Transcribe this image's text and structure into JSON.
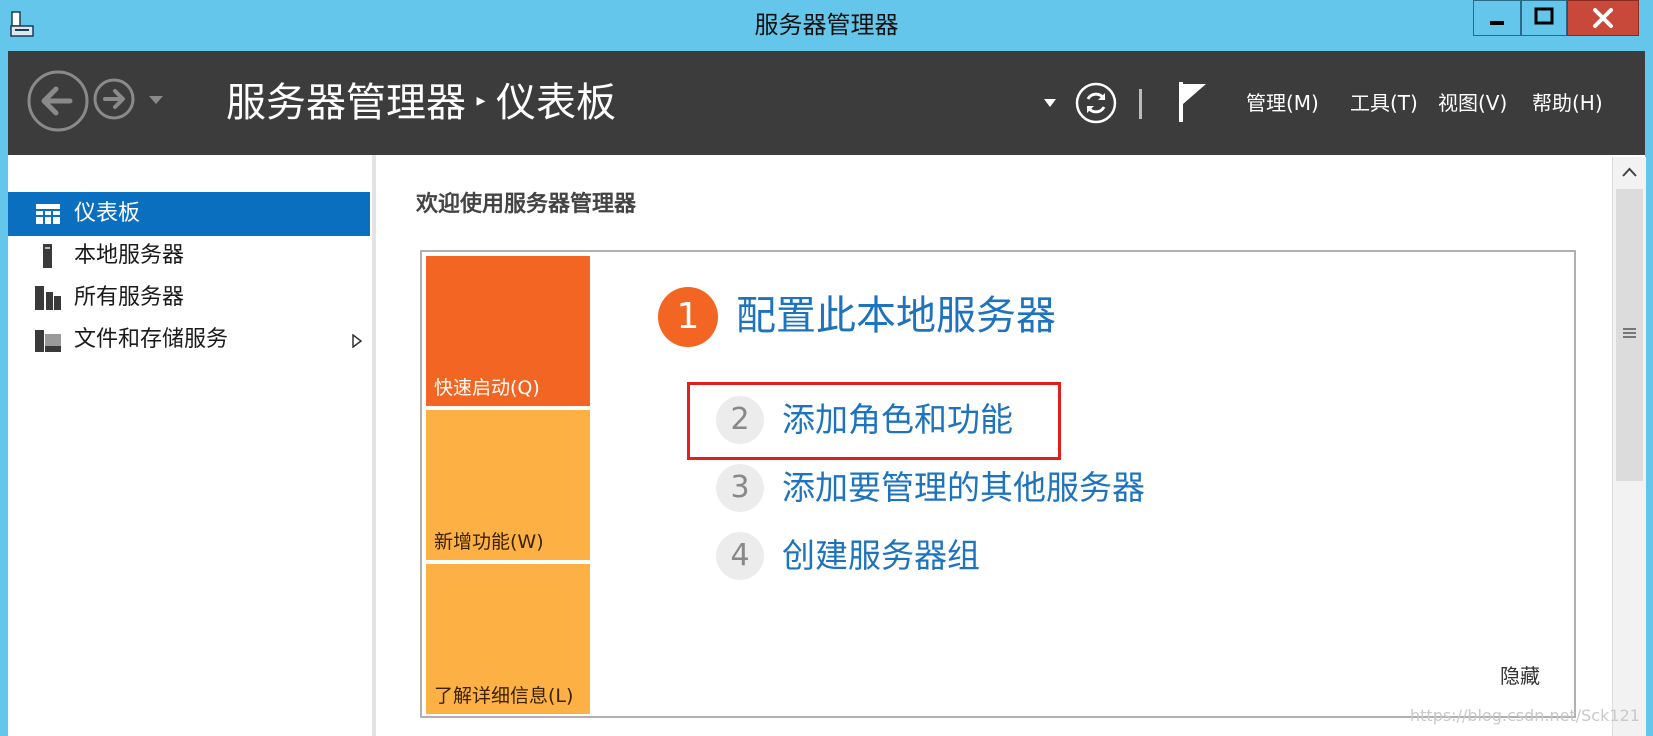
{
  "window": {
    "title": "服务器管理器",
    "buttons": [
      "minimize",
      "maximize",
      "close"
    ]
  },
  "header": {
    "breadcrumb_root": "服务器管理器",
    "breadcrumb_separator": "▸",
    "breadcrumb_current": "仪表板",
    "menu": {
      "manage": "管理(M)",
      "tools": "工具(T)",
      "view": "视图(V)",
      "help": "帮助(H)"
    }
  },
  "sidebar": {
    "items": [
      {
        "label": "仪表板",
        "icon": "dashboard-grid-icon",
        "active": true
      },
      {
        "label": "本地服务器",
        "icon": "server-icon"
      },
      {
        "label": "所有服务器",
        "icon": "servers-icon"
      },
      {
        "label": "文件和存储服务",
        "icon": "storage-icon",
        "has_submenu": true
      }
    ]
  },
  "main": {
    "welcome": "欢迎使用服务器管理器",
    "tiles": {
      "quick_start": "快速启动(Q)",
      "whats_new": "新增功能(W)",
      "learn_more": "了解详细信息(L)"
    },
    "steps": [
      {
        "num": "1",
        "text": "配置此本地服务器"
      },
      {
        "num": "2",
        "text": "添加角色和功能"
      },
      {
        "num": "3",
        "text": "添加要管理的其他服务器"
      },
      {
        "num": "4",
        "text": "创建服务器组"
      }
    ],
    "hide": "隐藏"
  },
  "watermark": "https://blog.csdn.net/Sck121",
  "colors": {
    "titlebar": "#63c6ea",
    "header": "#3c3c3c",
    "active_item": "#0a6fbf",
    "tile_orange": "#f26522",
    "tile_amber": "#fdb144",
    "link_blue": "#1e73be",
    "highlight_red": "#e0201c"
  }
}
